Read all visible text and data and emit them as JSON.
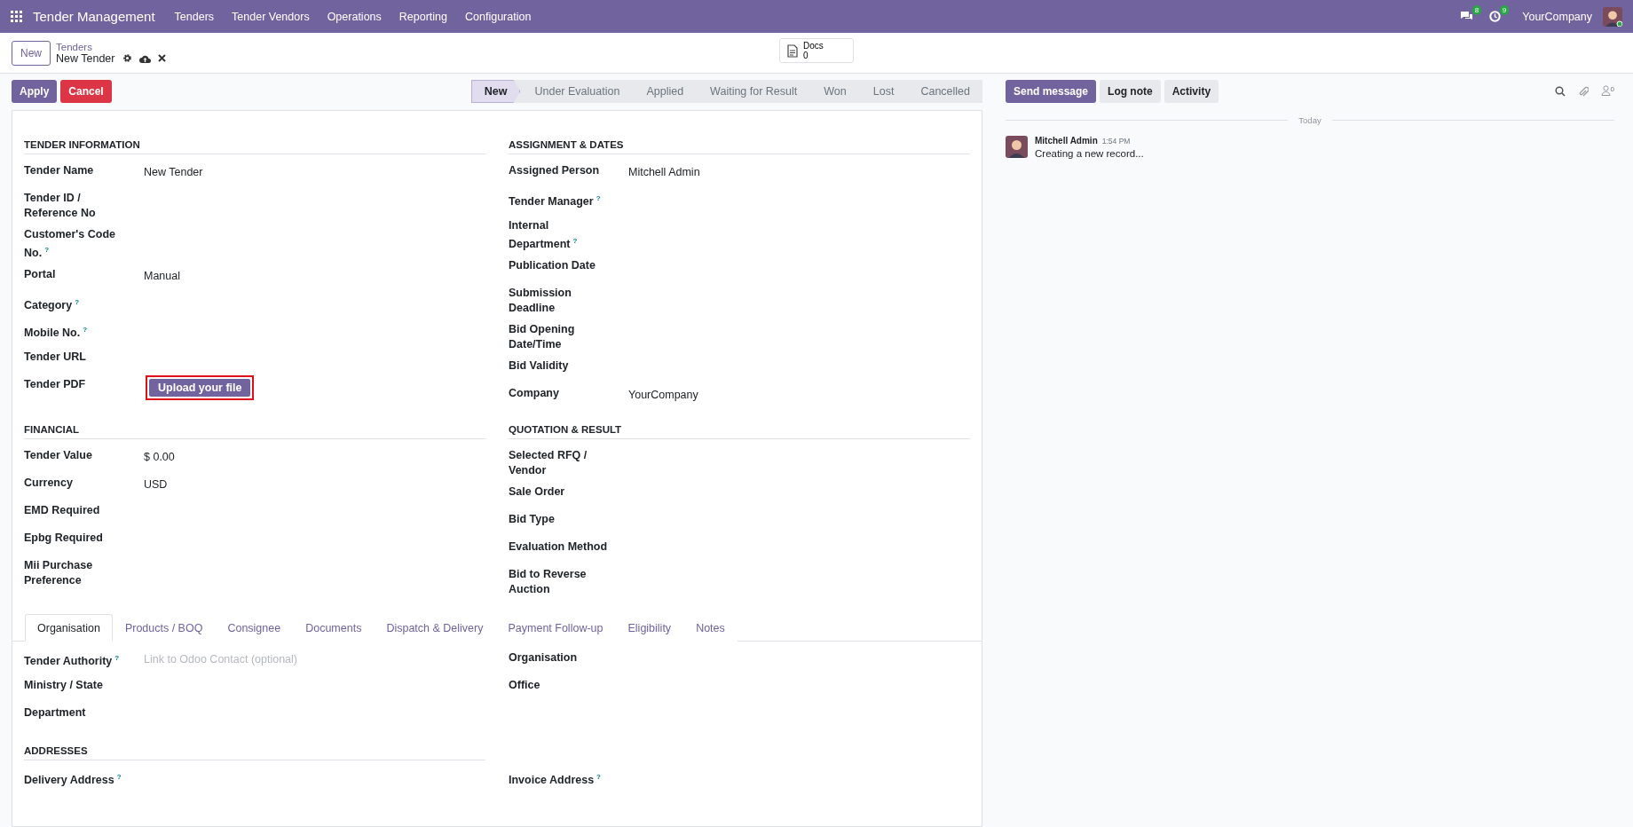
{
  "navbar": {
    "app_title": "Tender Management",
    "menu": [
      "Tenders",
      "Tender Vendors",
      "Operations",
      "Reporting",
      "Configuration"
    ],
    "chat_badge": "8",
    "activity_badge": "9",
    "company": "YourCompany"
  },
  "breadcrumb": {
    "new_button": "New",
    "parent": "Tenders",
    "current": "New Tender"
  },
  "docs": {
    "label": "Docs",
    "count": "0"
  },
  "actions": [
    {
      "label": "Apply",
      "kind": "primary"
    },
    {
      "label": "Cancel",
      "kind": "danger"
    }
  ],
  "statusbar": [
    {
      "label": "New",
      "selected": true
    },
    {
      "label": "Under Evaluation",
      "selected": false
    },
    {
      "label": "Applied",
      "selected": false
    },
    {
      "label": "Waiting for Result",
      "selected": false
    },
    {
      "label": "Won",
      "selected": false
    },
    {
      "label": "Lost",
      "selected": false
    },
    {
      "label": "Cancelled",
      "selected": false
    }
  ],
  "groups": [
    {
      "left": {
        "title": "TENDER INFORMATION",
        "fields": [
          {
            "label": "Tender Name",
            "value": "New Tender"
          },
          {
            "label": "Tender ID / Reference No"
          },
          {
            "label": "Customer's Code No.",
            "help": "?"
          },
          {
            "label": "Portal",
            "value": "Manual"
          },
          {
            "label": "Category",
            "help": "?"
          },
          {
            "label": "Mobile No.",
            "help": "?"
          },
          {
            "label": "Tender URL"
          },
          {
            "label": "Tender PDF",
            "upload": {
              "label": "Upload your file",
              "highlighted": true
            }
          }
        ]
      },
      "right": {
        "title": "ASSIGNMENT & DATES",
        "fields": [
          {
            "label": "Assigned Person",
            "value": "Mitchell Admin"
          },
          {
            "label": "Tender Manager",
            "help": "?"
          },
          {
            "label": "Internal Department",
            "help": "?"
          },
          {
            "label": "Publication Date"
          },
          {
            "label": "Submission Deadline"
          },
          {
            "label": "Bid Opening Date/Time"
          },
          {
            "label": "Bid Validity"
          },
          {
            "label": "Company",
            "value": "YourCompany"
          }
        ]
      }
    },
    {
      "left": {
        "title": "FINANCIAL",
        "fields": [
          {
            "label": "Tender Value",
            "value": "$ 0.00"
          },
          {
            "label": "Currency",
            "value": "USD"
          },
          {
            "label": "EMD Required"
          },
          {
            "label": "Epbg Required"
          },
          {
            "label": "Mii Purchase Preference"
          }
        ]
      },
      "right": {
        "title": "QUOTATION & RESULT",
        "fields": [
          {
            "label": "Selected RFQ / Vendor"
          },
          {
            "label": "Sale Order"
          },
          {
            "label": "Bid Type"
          },
          {
            "label": "Evaluation Method"
          },
          {
            "label": "Bid to Reverse Auction"
          }
        ]
      }
    }
  ],
  "notebook": {
    "tabs": [
      {
        "label": "Organisation",
        "selected": true
      },
      {
        "label": "Products / BOQ",
        "selected": false
      },
      {
        "label": "Consignee",
        "selected": false
      },
      {
        "label": "Documents",
        "selected": false
      },
      {
        "label": "Dispatch & Delivery",
        "selected": false
      },
      {
        "label": "Payment Follow-up",
        "selected": false
      },
      {
        "label": "Eligibility",
        "selected": false
      },
      {
        "label": "Notes",
        "selected": false
      }
    ],
    "left": [
      {
        "label": "Tender Authority",
        "help": "?",
        "placeholder": "Link to Odoo Contact (optional)"
      },
      {
        "label": "Ministry / State"
      },
      {
        "label": "Department"
      }
    ],
    "right": [
      {
        "label": "Organisation"
      },
      {
        "label": "Office"
      }
    ],
    "addresses": {
      "title": "ADDRESSES",
      "left": [
        {
          "label": "Delivery Address",
          "help": "?"
        }
      ],
      "right": [
        {
          "label": "Invoice Address",
          "help": "?"
        }
      ]
    }
  },
  "chatter": {
    "buttons": [
      {
        "label": "Send message",
        "kind": "primary"
      },
      {
        "label": "Log note",
        "kind": "secondary"
      },
      {
        "label": "Activity",
        "kind": "secondary"
      }
    ],
    "follower_count": "0",
    "date_separator": "Today",
    "messages": [
      {
        "author": "Mitchell Admin",
        "time": "1:54 PM",
        "body": "Creating a new record..."
      }
    ]
  }
}
